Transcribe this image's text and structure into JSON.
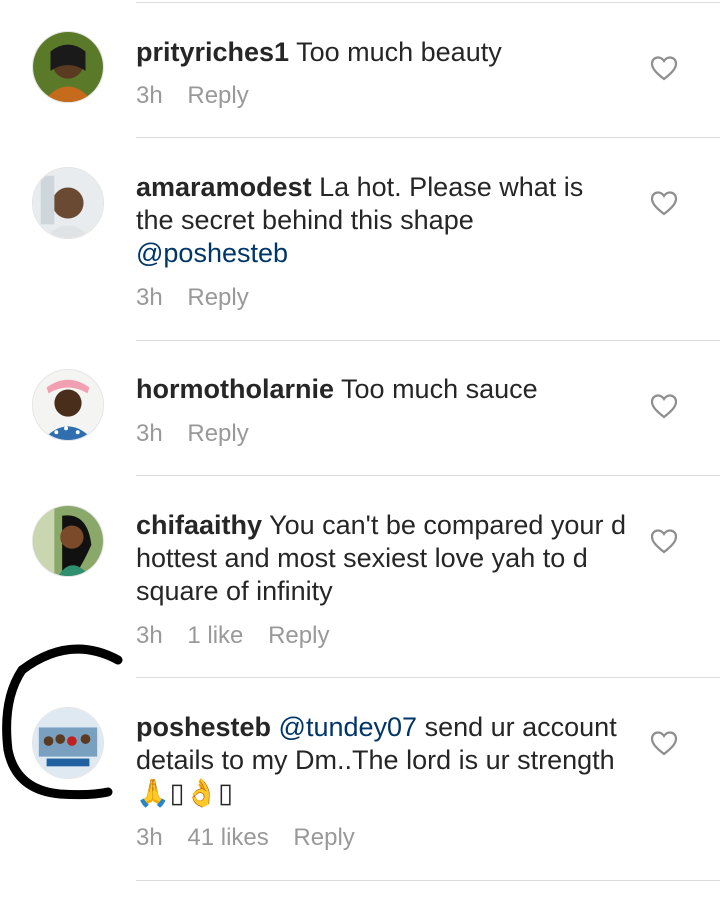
{
  "comments": [
    {
      "username": "prityriches1",
      "text_before": "Too much beauty",
      "mention": "",
      "text_after": "",
      "time": "3h",
      "likes": "",
      "reply": "Reply"
    },
    {
      "username": "amaramodest",
      "text_before": "La hot. Please what is the secret behind this shape",
      "mention": "@poshesteb",
      "text_after": "",
      "time": "3h",
      "likes": "",
      "reply": "Reply"
    },
    {
      "username": "hormotholarnie",
      "text_before": "Too much sauce",
      "mention": "",
      "text_after": "",
      "time": "3h",
      "likes": "",
      "reply": "Reply"
    },
    {
      "username": "chifaaithy",
      "text_before": "You can't be compared your d hottest and most sexiest love yah to d square of infinity",
      "mention": "",
      "text_after": "",
      "time": "3h",
      "likes": "1 like",
      "reply": "Reply"
    },
    {
      "username": "poshesteb",
      "text_before": "",
      "mention": "@tundey07",
      "text_after": "send ur account details to my Dm..The lord is ur strength 🙏▯👌▯",
      "time": "3h",
      "likes": "41 likes",
      "reply": "Reply"
    }
  ],
  "icons": {
    "like": "heart-outline-icon"
  },
  "colors": {
    "mention": "#003569",
    "meta": "#999999",
    "divider": "#dbdbdb"
  }
}
